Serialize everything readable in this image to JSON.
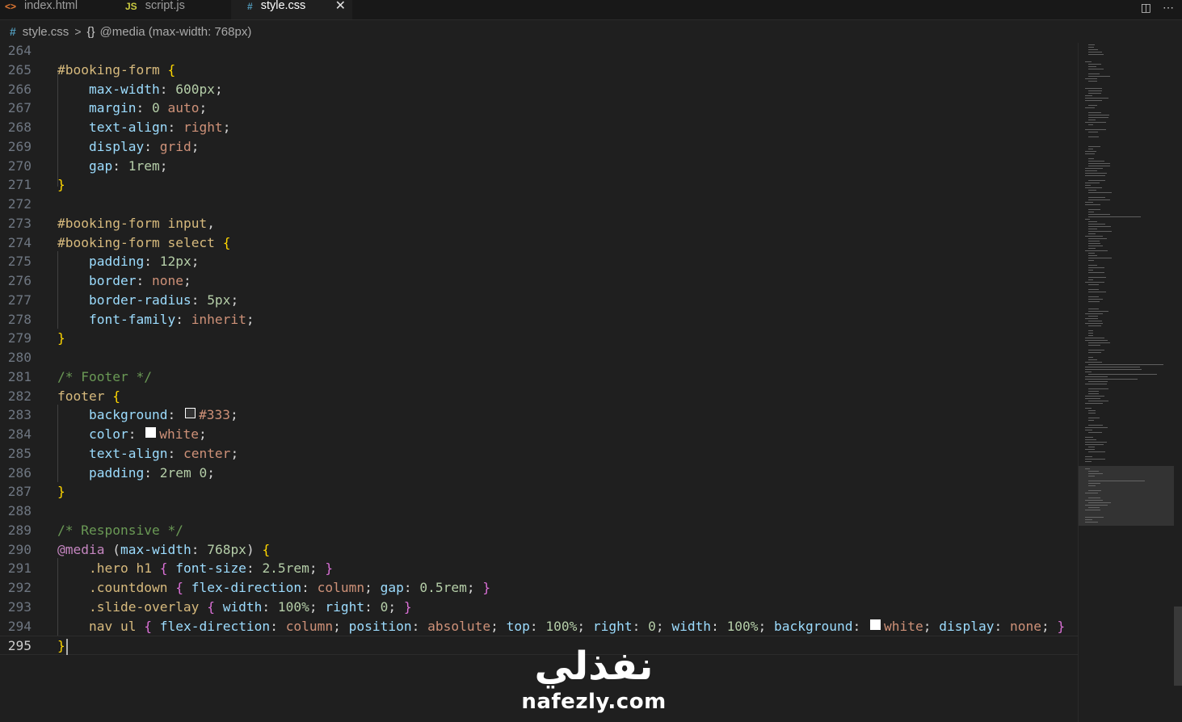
{
  "tabs": [
    {
      "icon": "<>",
      "label": "index.html"
    },
    {
      "icon": "JS",
      "label": "script.js"
    },
    {
      "icon": "#",
      "label": "style.css",
      "close": "✕"
    }
  ],
  "tab_actions": {
    "split": "◫",
    "more": "⋯"
  },
  "breadcrumb": {
    "file": "style.css",
    "sep": ">",
    "braces": "{}",
    "scope": "@media (max-width: 768px)"
  },
  "colors": {
    "background": "#1f1f1f",
    "selector": "#d7ba7d",
    "property": "#9cdcfe",
    "value": "#ce9178",
    "number": "#b5cea8",
    "comment": "#6a9955",
    "at_rule": "#c586c0"
  },
  "editor": {
    "lines": [
      {
        "n": "264",
        "t": []
      },
      {
        "n": "265",
        "t": [
          {
            "c": "sel",
            "v": "#booking-form"
          },
          {
            "c": "pun",
            "v": " "
          },
          {
            "c": "b1",
            "v": "{"
          }
        ]
      },
      {
        "n": "266",
        "t": [
          {
            "c": "pun",
            "v": "    "
          },
          {
            "c": "prop",
            "v": "max-width"
          },
          {
            "c": "pun",
            "v": ": "
          },
          {
            "c": "num",
            "v": "600px"
          },
          {
            "c": "pun",
            "v": ";"
          }
        ]
      },
      {
        "n": "267",
        "t": [
          {
            "c": "pun",
            "v": "    "
          },
          {
            "c": "prop",
            "v": "margin"
          },
          {
            "c": "pun",
            "v": ": "
          },
          {
            "c": "num",
            "v": "0"
          },
          {
            "c": "pun",
            "v": " "
          },
          {
            "c": "kw",
            "v": "auto"
          },
          {
            "c": "pun",
            "v": ";"
          }
        ]
      },
      {
        "n": "268",
        "t": [
          {
            "c": "pun",
            "v": "    "
          },
          {
            "c": "prop",
            "v": "text-align"
          },
          {
            "c": "pun",
            "v": ": "
          },
          {
            "c": "kw",
            "v": "right"
          },
          {
            "c": "pun",
            "v": ";"
          }
        ]
      },
      {
        "n": "269",
        "t": [
          {
            "c": "pun",
            "v": "    "
          },
          {
            "c": "prop",
            "v": "display"
          },
          {
            "c": "pun",
            "v": ": "
          },
          {
            "c": "kw",
            "v": "grid"
          },
          {
            "c": "pun",
            "v": ";"
          }
        ]
      },
      {
        "n": "270",
        "t": [
          {
            "c": "pun",
            "v": "    "
          },
          {
            "c": "prop",
            "v": "gap"
          },
          {
            "c": "pun",
            "v": ": "
          },
          {
            "c": "num",
            "v": "1rem"
          },
          {
            "c": "pun",
            "v": ";"
          }
        ]
      },
      {
        "n": "271",
        "t": [
          {
            "c": "b1",
            "v": "}"
          }
        ]
      },
      {
        "n": "272",
        "t": []
      },
      {
        "n": "273",
        "t": [
          {
            "c": "sel",
            "v": "#booking-form"
          },
          {
            "c": "pun",
            "v": " "
          },
          {
            "c": "tag",
            "v": "input"
          },
          {
            "c": "pun",
            "v": ","
          }
        ]
      },
      {
        "n": "274",
        "t": [
          {
            "c": "sel",
            "v": "#booking-form"
          },
          {
            "c": "pun",
            "v": " "
          },
          {
            "c": "tag",
            "v": "select"
          },
          {
            "c": "pun",
            "v": " "
          },
          {
            "c": "b1",
            "v": "{"
          }
        ]
      },
      {
        "n": "275",
        "t": [
          {
            "c": "pun",
            "v": "    "
          },
          {
            "c": "prop",
            "v": "padding"
          },
          {
            "c": "pun",
            "v": ": "
          },
          {
            "c": "num",
            "v": "12px"
          },
          {
            "c": "pun",
            "v": ";"
          }
        ]
      },
      {
        "n": "276",
        "t": [
          {
            "c": "pun",
            "v": "    "
          },
          {
            "c": "prop",
            "v": "border"
          },
          {
            "c": "pun",
            "v": ": "
          },
          {
            "c": "kw",
            "v": "none"
          },
          {
            "c": "pun",
            "v": ";"
          }
        ]
      },
      {
        "n": "277",
        "t": [
          {
            "c": "pun",
            "v": "    "
          },
          {
            "c": "prop",
            "v": "border-radius"
          },
          {
            "c": "pun",
            "v": ": "
          },
          {
            "c": "num",
            "v": "5px"
          },
          {
            "c": "pun",
            "v": ";"
          }
        ]
      },
      {
        "n": "278",
        "t": [
          {
            "c": "pun",
            "v": "    "
          },
          {
            "c": "prop",
            "v": "font-family"
          },
          {
            "c": "pun",
            "v": ": "
          },
          {
            "c": "kw",
            "v": "inherit"
          },
          {
            "c": "pun",
            "v": ";"
          }
        ]
      },
      {
        "n": "279",
        "t": [
          {
            "c": "b1",
            "v": "}"
          }
        ]
      },
      {
        "n": "280",
        "t": []
      },
      {
        "n": "281",
        "t": [
          {
            "c": "com",
            "v": "/* Footer */"
          }
        ]
      },
      {
        "n": "282",
        "t": [
          {
            "c": "tag",
            "v": "footer"
          },
          {
            "c": "pun",
            "v": " "
          },
          {
            "c": "b1",
            "v": "{"
          }
        ]
      },
      {
        "n": "283",
        "t": [
          {
            "c": "pun",
            "v": "    "
          },
          {
            "c": "prop",
            "v": "background"
          },
          {
            "c": "pun",
            "v": ": "
          },
          {
            "c": "swatch",
            "v": "#333333"
          },
          {
            "c": "kw",
            "v": "#333"
          },
          {
            "c": "pun",
            "v": ";"
          }
        ]
      },
      {
        "n": "284",
        "t": [
          {
            "c": "pun",
            "v": "    "
          },
          {
            "c": "prop",
            "v": "color"
          },
          {
            "c": "pun",
            "v": ": "
          },
          {
            "c": "swatch",
            "v": "#ffffff"
          },
          {
            "c": "kw",
            "v": "white"
          },
          {
            "c": "pun",
            "v": ";"
          }
        ]
      },
      {
        "n": "285",
        "t": [
          {
            "c": "pun",
            "v": "    "
          },
          {
            "c": "prop",
            "v": "text-align"
          },
          {
            "c": "pun",
            "v": ": "
          },
          {
            "c": "kw",
            "v": "center"
          },
          {
            "c": "pun",
            "v": ";"
          }
        ]
      },
      {
        "n": "286",
        "t": [
          {
            "c": "pun",
            "v": "    "
          },
          {
            "c": "prop",
            "v": "padding"
          },
          {
            "c": "pun",
            "v": ": "
          },
          {
            "c": "num",
            "v": "2rem"
          },
          {
            "c": "pun",
            "v": " "
          },
          {
            "c": "num",
            "v": "0"
          },
          {
            "c": "pun",
            "v": ";"
          }
        ]
      },
      {
        "n": "287",
        "t": [
          {
            "c": "b1",
            "v": "}"
          }
        ]
      },
      {
        "n": "288",
        "t": []
      },
      {
        "n": "289",
        "t": [
          {
            "c": "com",
            "v": "/* Responsive */"
          }
        ]
      },
      {
        "n": "290",
        "t": [
          {
            "c": "at",
            "v": "@media"
          },
          {
            "c": "pun",
            "v": " ("
          },
          {
            "c": "prop",
            "v": "max-width"
          },
          {
            "c": "pun",
            "v": ": "
          },
          {
            "c": "num",
            "v": "768px"
          },
          {
            "c": "pun",
            "v": ") "
          },
          {
            "c": "b1",
            "v": "{"
          }
        ]
      },
      {
        "n": "291",
        "t": [
          {
            "c": "pun",
            "v": "    "
          },
          {
            "c": "sel",
            "v": ".hero"
          },
          {
            "c": "pun",
            "v": " "
          },
          {
            "c": "tag",
            "v": "h1"
          },
          {
            "c": "pun",
            "v": " "
          },
          {
            "c": "b2",
            "v": "{"
          },
          {
            "c": "pun",
            "v": " "
          },
          {
            "c": "prop",
            "v": "font-size"
          },
          {
            "c": "pun",
            "v": ": "
          },
          {
            "c": "num",
            "v": "2.5rem"
          },
          {
            "c": "pun",
            "v": "; "
          },
          {
            "c": "b2",
            "v": "}"
          }
        ]
      },
      {
        "n": "292",
        "t": [
          {
            "c": "pun",
            "v": "    "
          },
          {
            "c": "sel",
            "v": ".countdown"
          },
          {
            "c": "pun",
            "v": " "
          },
          {
            "c": "b2",
            "v": "{"
          },
          {
            "c": "pun",
            "v": " "
          },
          {
            "c": "prop",
            "v": "flex-direction"
          },
          {
            "c": "pun",
            "v": ": "
          },
          {
            "c": "kw",
            "v": "column"
          },
          {
            "c": "pun",
            "v": "; "
          },
          {
            "c": "prop",
            "v": "gap"
          },
          {
            "c": "pun",
            "v": ": "
          },
          {
            "c": "num",
            "v": "0.5rem"
          },
          {
            "c": "pun",
            "v": "; "
          },
          {
            "c": "b2",
            "v": "}"
          }
        ]
      },
      {
        "n": "293",
        "t": [
          {
            "c": "pun",
            "v": "    "
          },
          {
            "c": "sel",
            "v": ".slide-overlay"
          },
          {
            "c": "pun",
            "v": " "
          },
          {
            "c": "b2",
            "v": "{"
          },
          {
            "c": "pun",
            "v": " "
          },
          {
            "c": "prop",
            "v": "width"
          },
          {
            "c": "pun",
            "v": ": "
          },
          {
            "c": "num",
            "v": "100%"
          },
          {
            "c": "pun",
            "v": "; "
          },
          {
            "c": "prop",
            "v": "right"
          },
          {
            "c": "pun",
            "v": ": "
          },
          {
            "c": "num",
            "v": "0"
          },
          {
            "c": "pun",
            "v": "; "
          },
          {
            "c": "b2",
            "v": "}"
          }
        ]
      },
      {
        "n": "294",
        "t": [
          {
            "c": "pun",
            "v": "    "
          },
          {
            "c": "tag",
            "v": "nav"
          },
          {
            "c": "pun",
            "v": " "
          },
          {
            "c": "tag",
            "v": "ul"
          },
          {
            "c": "pun",
            "v": " "
          },
          {
            "c": "b2",
            "v": "{"
          },
          {
            "c": "pun",
            "v": " "
          },
          {
            "c": "prop",
            "v": "flex-direction"
          },
          {
            "c": "pun",
            "v": ": "
          },
          {
            "c": "kw",
            "v": "column"
          },
          {
            "c": "pun",
            "v": "; "
          },
          {
            "c": "prop",
            "v": "position"
          },
          {
            "c": "pun",
            "v": ": "
          },
          {
            "c": "kw",
            "v": "absolute"
          },
          {
            "c": "pun",
            "v": "; "
          },
          {
            "c": "prop",
            "v": "top"
          },
          {
            "c": "pun",
            "v": ": "
          },
          {
            "c": "num",
            "v": "100%"
          },
          {
            "c": "pun",
            "v": "; "
          },
          {
            "c": "prop",
            "v": "right"
          },
          {
            "c": "pun",
            "v": ": "
          },
          {
            "c": "num",
            "v": "0"
          },
          {
            "c": "pun",
            "v": "; "
          },
          {
            "c": "prop",
            "v": "width"
          },
          {
            "c": "pun",
            "v": ": "
          },
          {
            "c": "num",
            "v": "100%"
          },
          {
            "c": "pun",
            "v": "; "
          },
          {
            "c": "prop",
            "v": "background"
          },
          {
            "c": "pun",
            "v": ": "
          },
          {
            "c": "swatch",
            "v": "#ffffff"
          },
          {
            "c": "kw",
            "v": "white"
          },
          {
            "c": "pun",
            "v": "; "
          },
          {
            "c": "prop",
            "v": "display"
          },
          {
            "c": "pun",
            "v": ": "
          },
          {
            "c": "kw",
            "v": "none"
          },
          {
            "c": "pun",
            "v": "; "
          },
          {
            "c": "b2",
            "v": "}"
          }
        ]
      },
      {
        "n": "295",
        "t": [
          {
            "c": "b1",
            "v": "}"
          }
        ],
        "current": true
      }
    ]
  },
  "watermark": {
    "arabic": "نفذلي",
    "latin": "nafezly.com"
  }
}
